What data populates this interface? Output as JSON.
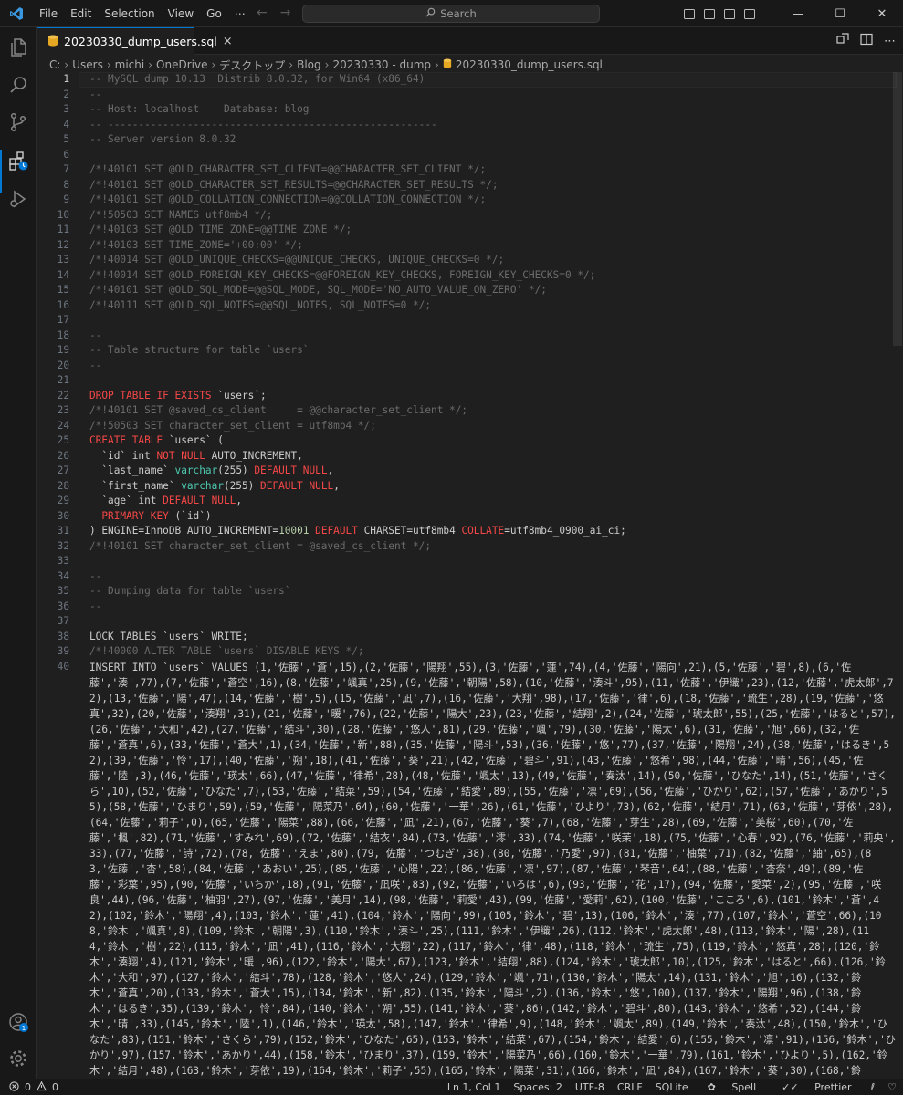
{
  "menu": [
    "File",
    "Edit",
    "Selection",
    "View",
    "Go",
    "⋯"
  ],
  "search": {
    "label": "Search"
  },
  "tab": {
    "title": "20230330_dump_users.sql",
    "close": "×"
  },
  "breadcrumb": [
    "C:",
    "Users",
    "michi",
    "OneDrive",
    "デスクトップ",
    "Blog",
    "20230330 - dump",
    "20230330_dump_users.sql"
  ],
  "line_numbers": [
    1,
    2,
    3,
    4,
    5,
    6,
    7,
    8,
    9,
    10,
    11,
    12,
    13,
    14,
    15,
    16,
    17,
    18,
    19,
    20,
    21,
    22,
    23,
    24,
    25,
    26,
    27,
    28,
    29,
    30,
    31,
    32,
    33,
    34,
    35,
    36,
    37,
    38,
    39,
    40
  ],
  "code": {
    "l1": "-- MySQL dump 10.13  Distrib 8.0.32, for Win64 (x86_64)",
    "l2": "--",
    "l3": "-- Host: localhost    Database: blog",
    "l4": "-- ------------------------------------------------------",
    "l5": "-- Server version 8.0.32",
    "l7": "/*!40101 SET @OLD_CHARACTER_SET_CLIENT=@@CHARACTER_SET_CLIENT */;",
    "l8": "/*!40101 SET @OLD_CHARACTER_SET_RESULTS=@@CHARACTER_SET_RESULTS */;",
    "l9": "/*!40101 SET @OLD_COLLATION_CONNECTION=@@COLLATION_CONNECTION */;",
    "l10": "/*!50503 SET NAMES utf8mb4 */;",
    "l11": "/*!40103 SET @OLD_TIME_ZONE=@@TIME_ZONE */;",
    "l12": "/*!40103 SET TIME_ZONE='+00:00' */;",
    "l13": "/*!40014 SET @OLD_UNIQUE_CHECKS=@@UNIQUE_CHECKS, UNIQUE_CHECKS=0 */;",
    "l14": "/*!40014 SET @OLD_FOREIGN_KEY_CHECKS=@@FOREIGN_KEY_CHECKS, FOREIGN_KEY_CHECKS=0 */;",
    "l15": "/*!40101 SET @OLD_SQL_MODE=@@SQL_MODE, SQL_MODE='NO_AUTO_VALUE_ON_ZERO' */;",
    "l16": "/*!40111 SET @OLD_SQL_NOTES=@@SQL_NOTES, SQL_NOTES=0 */;",
    "l18": "--",
    "l19": "-- Table structure for table `users`",
    "l20": "--",
    "l22a": "DROP TABLE IF EXISTS",
    "l22b": " `users`;",
    "l23": "/*!40101 SET @saved_cs_client     = @@character_set_client */;",
    "l24": "/*!50503 SET character_set_client = utf8mb4 */;",
    "l25a": "CREATE TABLE",
    "l25b": " `users` (",
    "l26a": "  `id` int ",
    "l26b": "NOT NULL",
    "l26c": " AUTO_INCREMENT,",
    "l27a": "  `last_name` ",
    "l27b": "varchar",
    "l27c": "(255) ",
    "l27d": "DEFAULT NULL",
    "l27e": ",",
    "l28a": "  `first_name` ",
    "l28b": "varchar",
    "l28c": "(255) ",
    "l28d": "DEFAULT NULL",
    "l28e": ",",
    "l29a": "  `age` int ",
    "l29b": "DEFAULT NULL",
    "l29c": ",",
    "l30a": "  PRIMARY KEY",
    "l30b": " (`id`)",
    "l31a": ") ENGINE=InnoDB AUTO_INCREMENT=",
    "l31b": "10001",
    "l31c": " DEFAULT",
    "l31d": " CHARSET=utf8mb4 ",
    "l31e": "COLLATE",
    "l31f": "=utf8mb4_0900_ai_ci;",
    "l32": "/*!40101 SET character_set_client = @saved_cs_client */;",
    "l34": "--",
    "l35": "-- Dumping data for table `users`",
    "l36": "--",
    "l38": "LOCK TABLES `users` WRITE;",
    "l39": "/*!40000 ALTER TABLE `users` DISABLE KEYS */;",
    "l40": "INSERT INTO `users` VALUES (1,'佐藤','蒼',15),(2,'佐藤','陽翔',55),(3,'佐藤','蓮',74),(4,'佐藤','陽向',21),(5,'佐藤','碧',8),(6,'佐藤','湊',77),(7,'佐藤','蒼空',16),(8,'佐藤','颯真',25),(9,'佐藤','朝陽',58),(10,'佐藤','湊斗',95),(11,'佐藤','伊織',23),(12,'佐藤','虎太郎',72),(13,'佐藤','陽',47),(14,'佐藤','樹',5),(15,'佐藤','凪',7),(16,'佐藤','大翔',98),(17,'佐藤','律',6),(18,'佐藤','琉生',28),(19,'佐藤','悠真',32),(20,'佐藤','湊翔',31),(21,'佐藤','暖',76),(22,'佐藤','陽大',23),(23,'佐藤','結翔',2),(24,'佐藤','琥太郎',55),(25,'佐藤','はると',57),(26,'佐藤','大和',42),(27,'佐藤','結斗',30),(28,'佐藤','悠人',81),(29,'佐藤','颯',79),(30,'佐藤','陽太',6),(31,'佐藤','旭',66),(32,'佐藤','蒼真',6),(33,'佐藤','蒼大',1),(34,'佐藤','新',88),(35,'佐藤','陽斗',53),(36,'佐藤','悠',77),(37,'佐藤','陽翔',24),(38,'佐藤','はるき',52),(39,'佐藤','怜',17),(40,'佐藤','朔',18),(41,'佐藤','葵',21),(42,'佐藤','碧斗',91),(43,'佐藤','悠希',98),(44,'佐藤','晴',56),(45,'佐藤','陸',3),(46,'佐藤','瑛太',66),(47,'佐藤','律希',28),(48,'佐藤','颯太',13),(49,'佐藤','奏汰',14),(50,'佐藤','ひなた',14),(51,'佐藤','さくら',10),(52,'佐藤','ひなた',7),(53,'佐藤','結菜',59),(54,'佐藤','結愛',89),(55,'佐藤','凛',69),(56,'佐藤','ひかり',62),(57,'佐藤','あかり',55),(58,'佐藤','ひまり',59),(59,'佐藤','陽菜乃',64),(60,'佐藤','一華',26),(61,'佐藤','ひより',73),(62,'佐藤','結月',71),(63,'佐藤','芽依',28),(64,'佐藤','莉子',0),(65,'佐藤','陽菜',88),(66,'佐藤','凪',21),(67,'佐藤','葵',7),(68,'佐藤','芽生',28),(69,'佐藤','美桜',60),(70,'佐藤','楓',82),(71,'佐藤','すみれ',69),(72,'佐藤','結衣',84),(73,'佐藤','澪',33),(74,'佐藤','咲茉',18),(75,'佐藤','心春',92),(76,'佐藤','莉央',33),(77,'佐藤','詩',72),(78,'佐藤','えま',80),(79,'佐藤','つむぎ',38),(80,'佐藤','乃愛',97),(81,'佐藤','柚葉',71),(82,'佐藤','紬',65),(83,'佐藤','杏',58),(84,'佐藤','あおい',25),(85,'佐藤','心陽',22),(86,'佐藤','凛',97),(87,'佐藤','琴音',64),(88,'佐藤','杏奈',49),(89,'佐藤','彩葉',95),(90,'佐藤','いちか',18),(91,'佐藤','凪咲',83),(92,'佐藤','いろは',6),(93,'佐藤','花',17),(94,'佐藤','愛菜',2),(95,'佐藤','咲良',44),(96,'佐藤','柚羽',27),(97,'佐藤','美月',14),(98,'佐藤','莉愛',43),(99,'佐藤','愛莉',62),(100,'佐藤','こころ',6),(101,'鈴木','蒼',42),(102,'鈴木','陽翔',4),(103,'鈴木','蓮',41),(104,'鈴木','陽向',99),(105,'鈴木','碧',13),(106,'鈴木','湊',77),(107,'鈴木','蒼空',66),(108,'鈴木','颯真',8),(109,'鈴木','朝陽',3),(110,'鈴木','湊斗',25),(111,'鈴木','伊織',26),(112,'鈴木','虎太郎',48),(113,'鈴木','陽',28),(114,'鈴木','樹',22),(115,'鈴木','凪',41),(116,'鈴木','大翔',22),(117,'鈴木','律',48),(118,'鈴木','琉生',75),(119,'鈴木','悠真',28),(120,'鈴木','湊翔',4),(121,'鈴木','暖',96),(122,'鈴木','陽大',67),(123,'鈴木','結翔',88),(124,'鈴木','琥太郎',10),(125,'鈴木','はると',66),(126,'鈴木','大和',97),(127,'鈴木','結斗',78),(128,'鈴木','悠人',24),(129,'鈴木','颯',71),(130,'鈴木','陽太',14),(131,'鈴木','旭',16),(132,'鈴木','蒼真',20),(133,'鈴木','蒼大',15),(134,'鈴木','新',82),(135,'鈴木','陽斗',2),(136,'鈴木','悠',100),(137,'鈴木','陽翔',96),(138,'鈴木','はるき',35),(139,'鈴木','怜',84),(140,'鈴木','朔',55),(141,'鈴木','葵',86),(142,'鈴木','碧斗',80),(143,'鈴木','悠希',52),(144,'鈴木','晴',33),(145,'鈴木','陸',1),(146,'鈴木','瑛太',58),(147,'鈴木','律希',9),(148,'鈴木','颯太',89),(149,'鈴木','奏汰',48),(150,'鈴木','ひなた',83),(151,'鈴木','さくら',79),(152,'鈴木','ひなた',65),(153,'鈴木','結菜',67),(154,'鈴木','結愛',6),(155,'鈴木','凛',91),(156,'鈴木','ひかり',97),(157,'鈴木','あかり',44),(158,'鈴木','ひまり',37),(159,'鈴木','陽菜乃',66),(160,'鈴木','一華',79),(161,'鈴木','ひより',5),(162,'鈴木','結月',48),(163,'鈴木','芽依',19),(164,'鈴木','莉子',55),(165,'鈴木','陽菜',31),(166,'鈴木','凪',84),(167,'鈴木','葵',30),(168,'鈴木','芽生',23),(169,'鈴木','美桜',85),(170,'鈴木','楓',82),(171,'鈴木','すみれ',35),(172,'鈴木','結衣',93),(173,'鈴木','澪',46),(174,'鈴木','咲茉',39),(175,'鈴木','心春',11),(176,'鈴木','莉央',1),(177,'鈴木','詩',2),(178,'鈴木','えま',27),(179,'鈴木','つむぎ',90),(180,'鈴木','乃愛',97),(181,'鈴木','柚葉',1),(182,'鈴木','紬',"
  },
  "status": {
    "errors": "0",
    "warnings": "0",
    "position": "Ln 1, Col 1",
    "spaces": "Spaces: 2",
    "encoding": "UTF-8",
    "eol": "CRLF",
    "language": "SQLite",
    "spell": "Spell",
    "prettier": "Prettier"
  },
  "colors": {
    "accent": "#0078d4",
    "background": "#1f1f1f",
    "comment": "#6a9955",
    "keyword": "#f44747",
    "type": "#4ec9b0",
    "number": "#b5cea8"
  }
}
